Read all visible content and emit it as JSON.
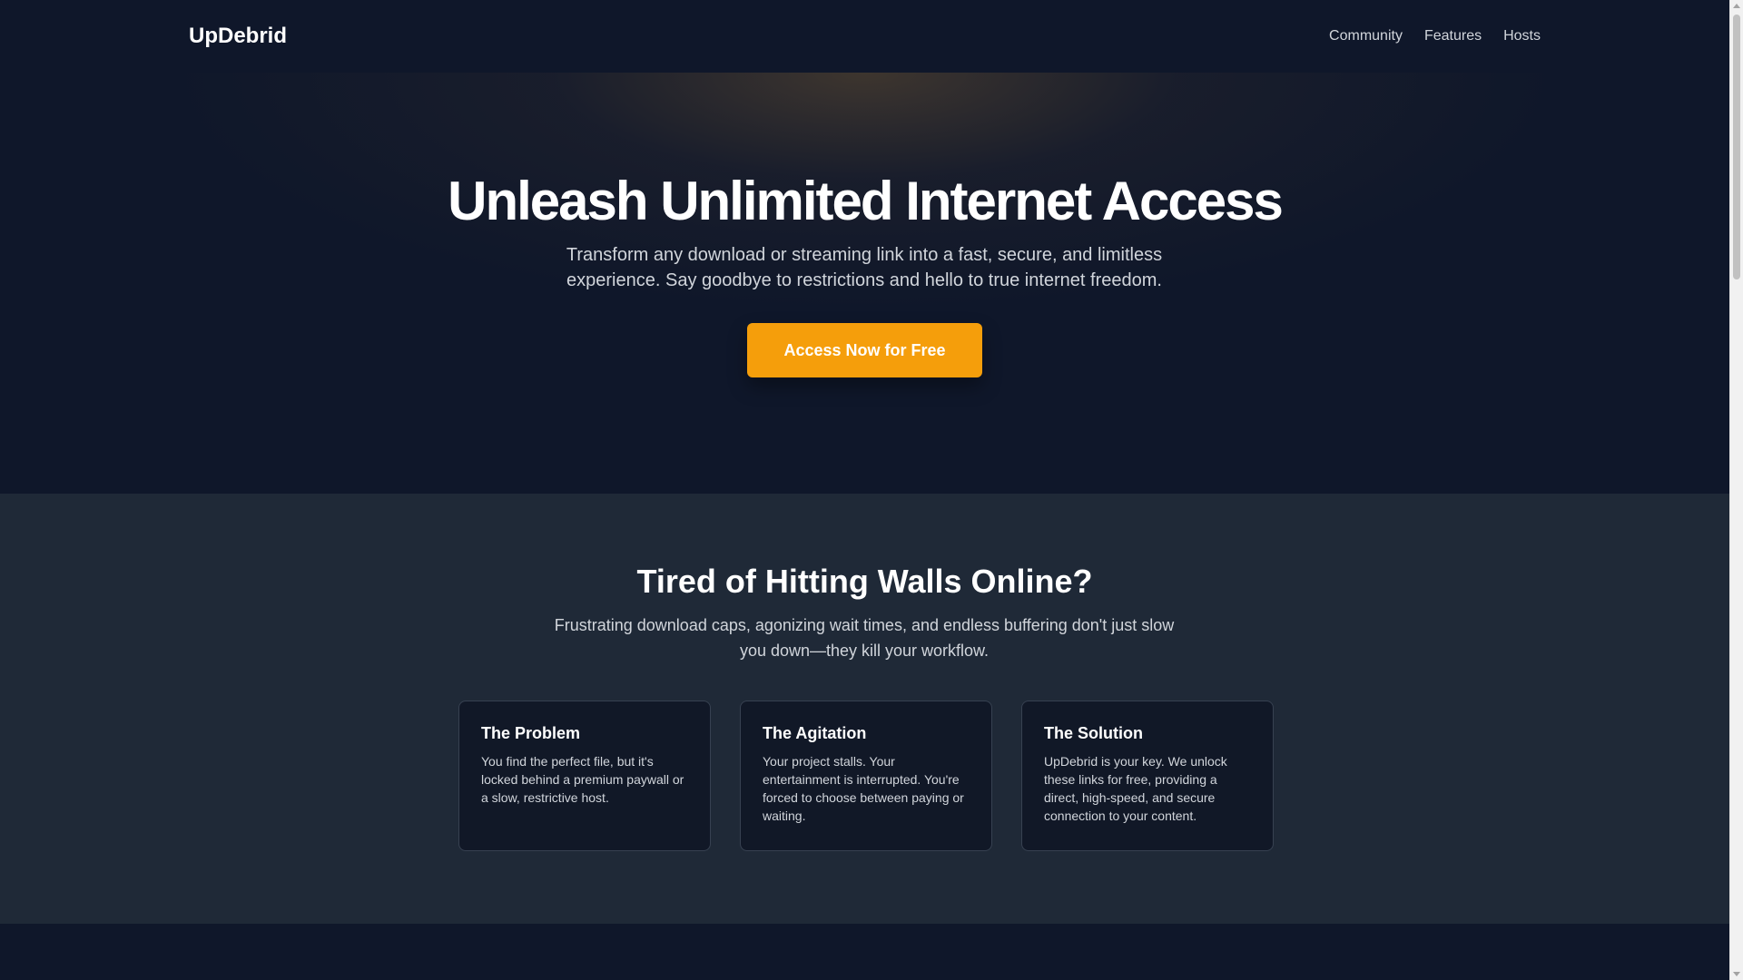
{
  "header": {
    "brand": "UpDebrid",
    "nav": [
      "Community",
      "Features",
      "Hosts"
    ]
  },
  "hero": {
    "title": "Unleash Unlimited Internet Access",
    "subtitle_line1": "Transform any download or streaming link into a fast, secure, and limitless",
    "subtitle_line2": "experience. Say goodbye to restrictions and hello to true internet freedom.",
    "cta_label": "Access Now for Free"
  },
  "problem_section": {
    "title": "Tired of Hitting Walls Online?",
    "subtitle_line1": "Frustrating download caps, agonizing wait times, and endless buffering don't just slow",
    "subtitle_line2": "you down—they kill your workflow.",
    "cards": [
      {
        "title": "The Problem",
        "body": "You find the perfect file, but it's locked behind a premium paywall or a slow, restrictive host."
      },
      {
        "title": "The Agitation",
        "body": "Your project stalls. Your entertainment is interrupted. You're forced to choose between paying or waiting."
      },
      {
        "title": "The Solution",
        "body": "UpDebrid is your key. We unlock these links for free, providing a direct, high-speed, and secure connection to your content."
      }
    ]
  },
  "colors": {
    "accent": "#f59e0b",
    "background_dark": "#0f172a",
    "section_background": "#1f2937"
  }
}
